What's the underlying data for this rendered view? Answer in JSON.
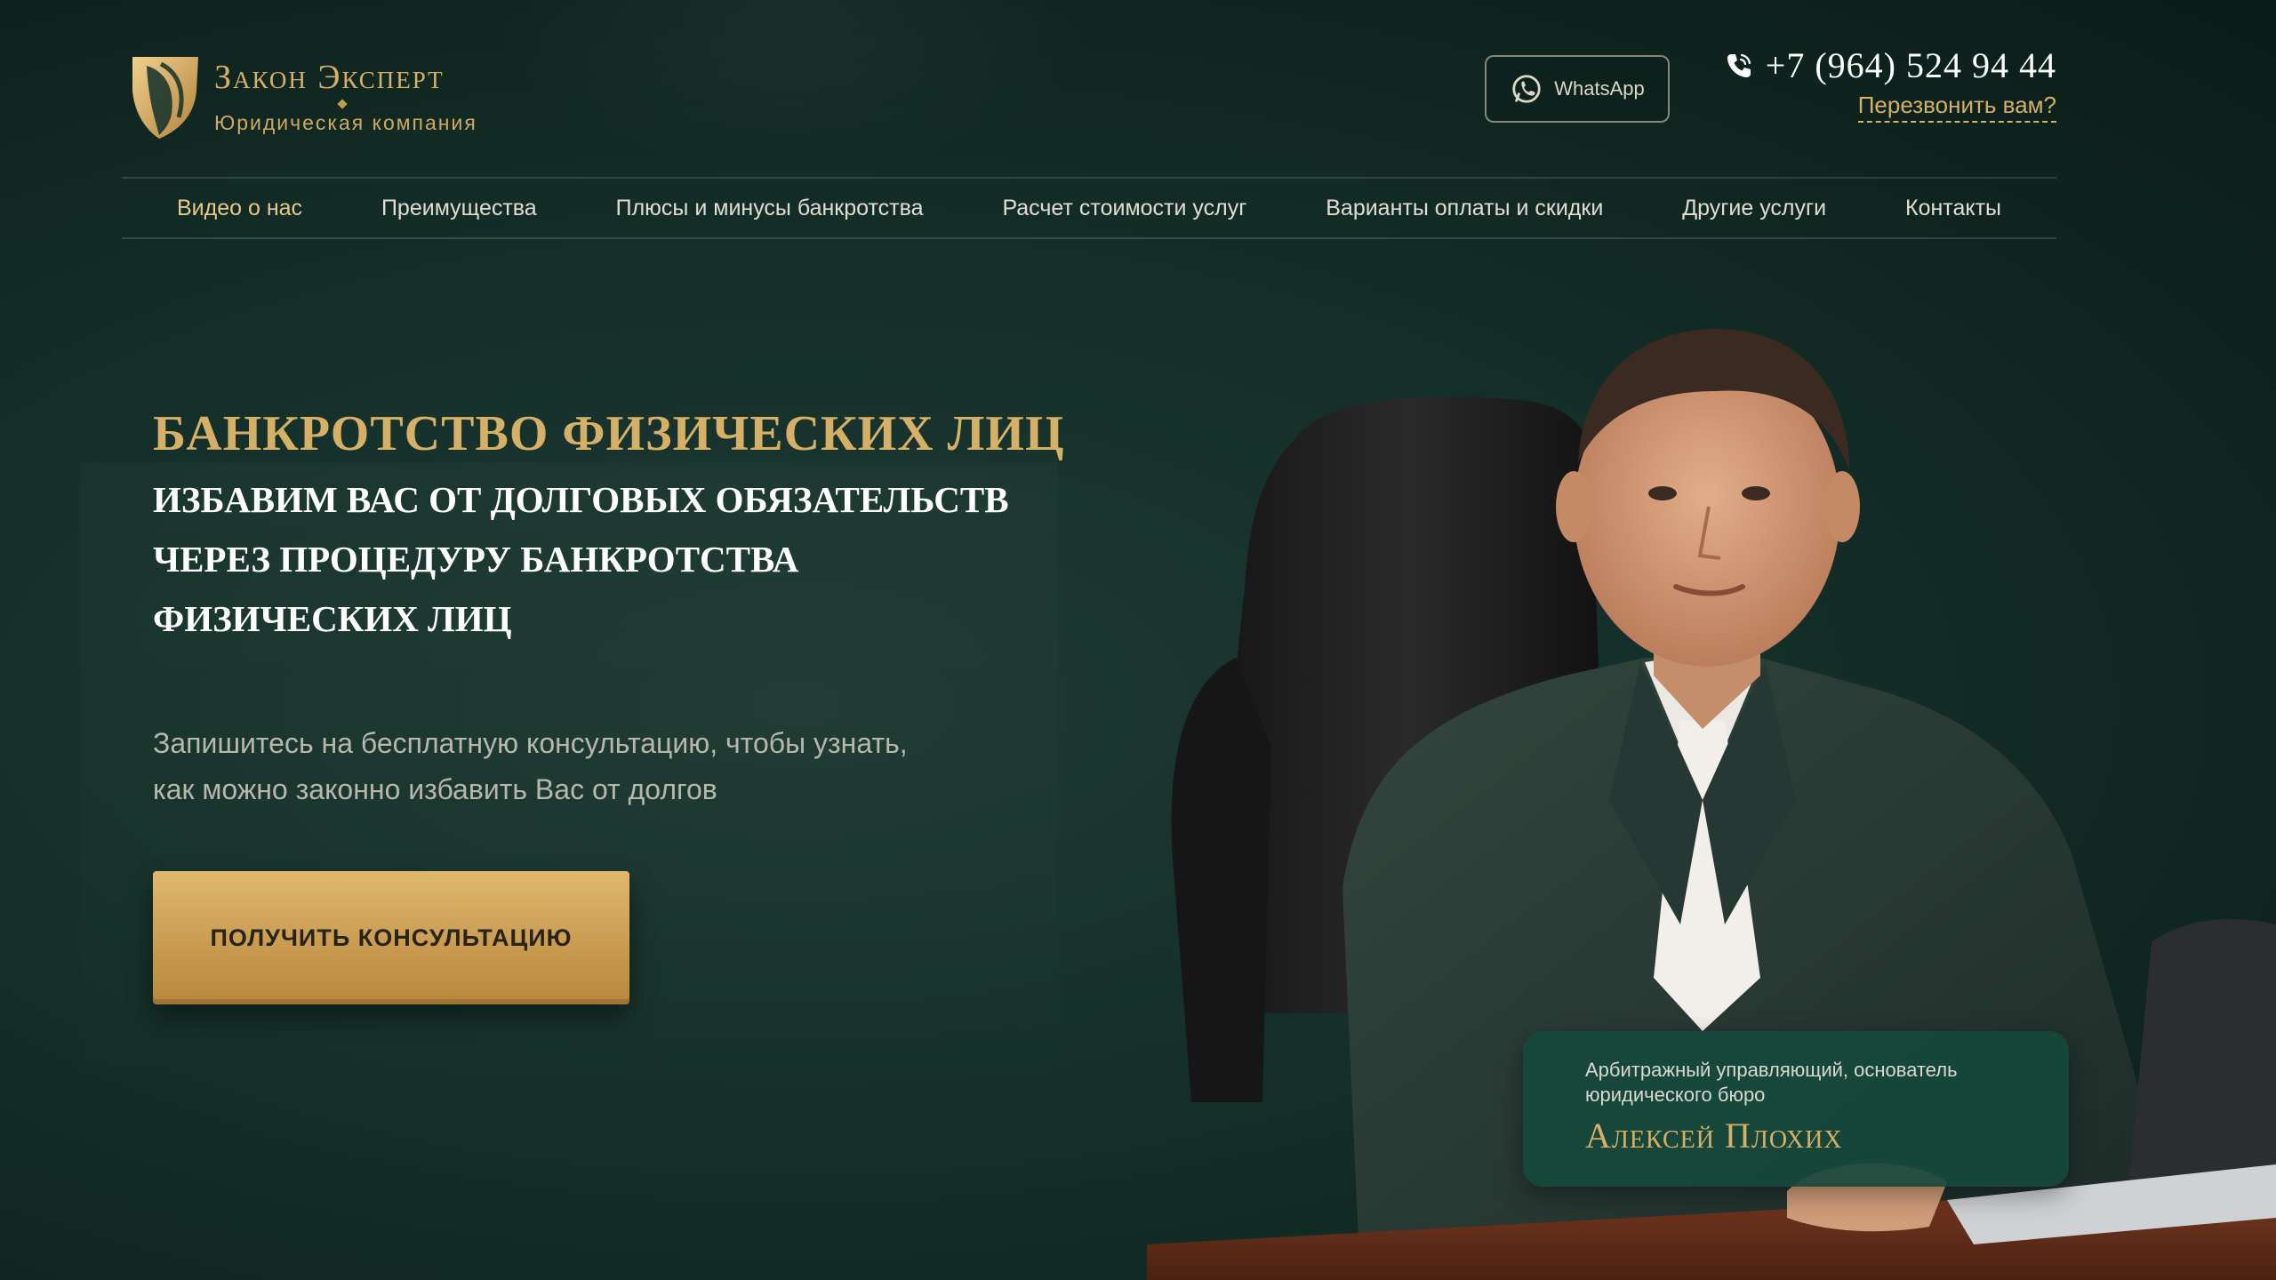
{
  "header": {
    "logo_title": "Закон Эксперт",
    "logo_subtitle": "Юридическая компания",
    "whatsapp_label": "WhatsApp",
    "phone": "+7 (964) 524 94 44",
    "callback_label": "Перезвонить вам?"
  },
  "nav": {
    "items": [
      {
        "label": "Видео о нас",
        "active": true
      },
      {
        "label": "Преимущества"
      },
      {
        "label": "Плюсы и минусы банкротства"
      },
      {
        "label": "Расчет стоимости услуг"
      },
      {
        "label": "Варианты оплаты и скидки"
      },
      {
        "label": "Другие услуги"
      },
      {
        "label": "Контакты"
      }
    ]
  },
  "hero": {
    "title": "БАНКРОТСТВО ФИЗИЧЕСКИХ ЛИЦ",
    "subtitle": "ИЗБАВИМ ВАС ОТ ДОЛГОВЫХ ОБЯЗАТЕЛЬСТВ ЧЕРЕЗ ПРОЦЕДУРУ БАНКРОТСТВА ФИЗИЧЕСКИХ ЛИЦ",
    "description": "Запишитесь на бесплатную консультацию, чтобы узнать, как можно законно избавить Вас от долгов",
    "cta_label": "ПОЛУЧИТЬ КОНСУЛЬТАЦИЮ"
  },
  "founder": {
    "role": "Арбитражный управляющий, основатель юридического бюро",
    "name": "Алексей Плохих"
  },
  "colors": {
    "background": "#15302a",
    "accent_gold": "#d6b067",
    "caption_card": "#16483c"
  },
  "icons": {
    "logo": "shield-leaf-logo",
    "whatsapp": "whatsapp-icon",
    "phone": "phone-icon"
  }
}
